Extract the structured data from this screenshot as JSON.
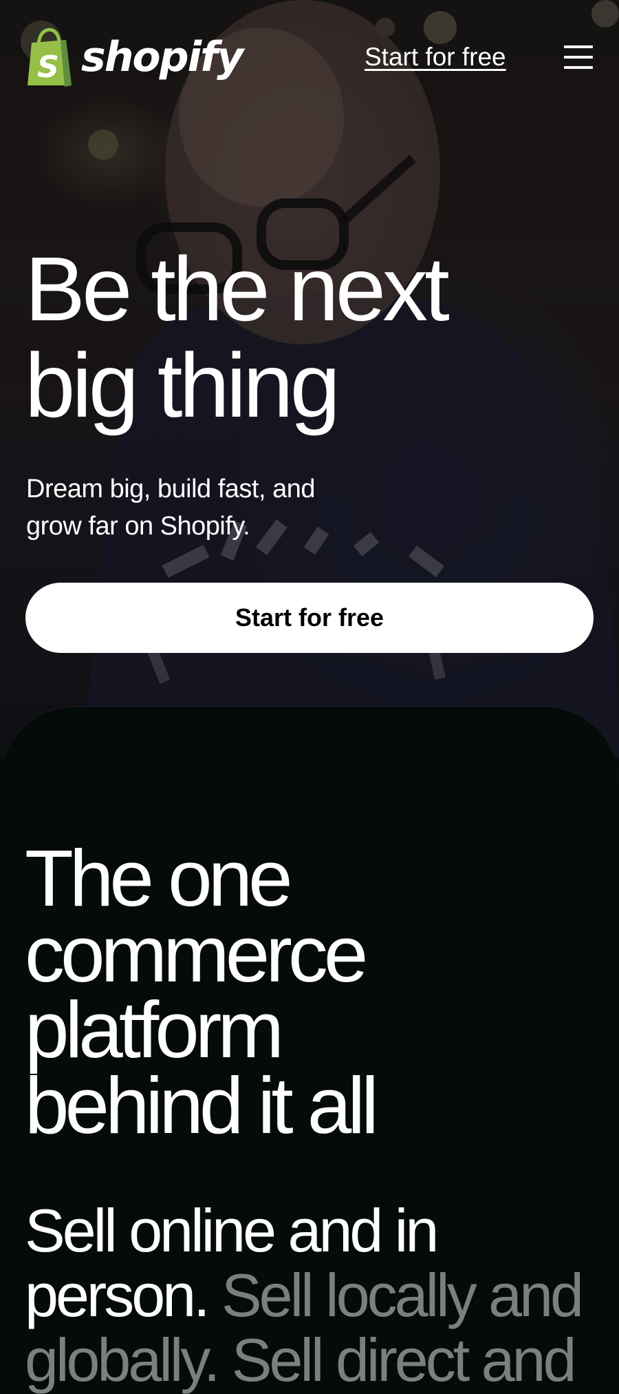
{
  "header": {
    "logo_text": "shopify",
    "logo_mark": "S",
    "cta_label": "Start for free",
    "menu_icon": "hamburger-menu-icon"
  },
  "hero": {
    "title_lines": [
      "Be the next",
      "big thing"
    ],
    "subtitle_lines": [
      "Dream big, build fast, and",
      "grow far on Shopify."
    ],
    "cta_label": "Start for free"
  },
  "section": {
    "title_lines": [
      "The one",
      "commerce",
      "platform",
      "behind it all"
    ],
    "para_line1": "Sell online and in",
    "para_line2_strong": "person.",
    "para_line2_muted": "Sell locally and",
    "para_line3_muted": "globally. Sell direct and"
  },
  "colors": {
    "brand_green": "#95bf47",
    "brand_green_dark": "#5e8e3e",
    "section_bg": "#050b09",
    "muted_text": "#7b7f7f"
  }
}
